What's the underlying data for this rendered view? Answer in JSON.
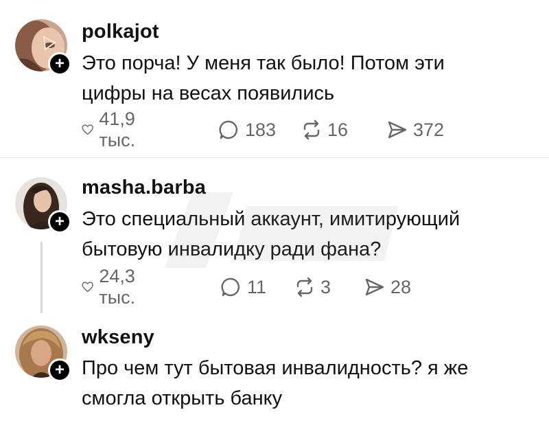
{
  "comments": [
    {
      "username": "polkajot",
      "text_line1": "Это порча! У меня так было! Потом эти",
      "text_line2": "цифры на весах появились",
      "likes": "41,9 тыс.",
      "replies": "183",
      "reposts": "16",
      "shares": "372"
    },
    {
      "username": "masha.barba",
      "text_line1": "Это специальный аккаунт, имитирующий",
      "text_line2": "бытовую инвалидку ради фана?",
      "likes": "24,3 тыс.",
      "replies": "11",
      "reposts": "3",
      "shares": "28"
    },
    {
      "username": "wkseny",
      "text_line1": "Про чем тут бытовая инвалидность? я же",
      "text_line2": "смогла открыть банку"
    }
  ],
  "icons": {
    "like": "heart-icon",
    "reply": "comment-icon",
    "repost": "repost-icon",
    "share": "send-icon",
    "follow": "plus-icon"
  },
  "colors": {
    "text": "#111111",
    "meta": "#666666",
    "divider": "#e6e6e6"
  }
}
